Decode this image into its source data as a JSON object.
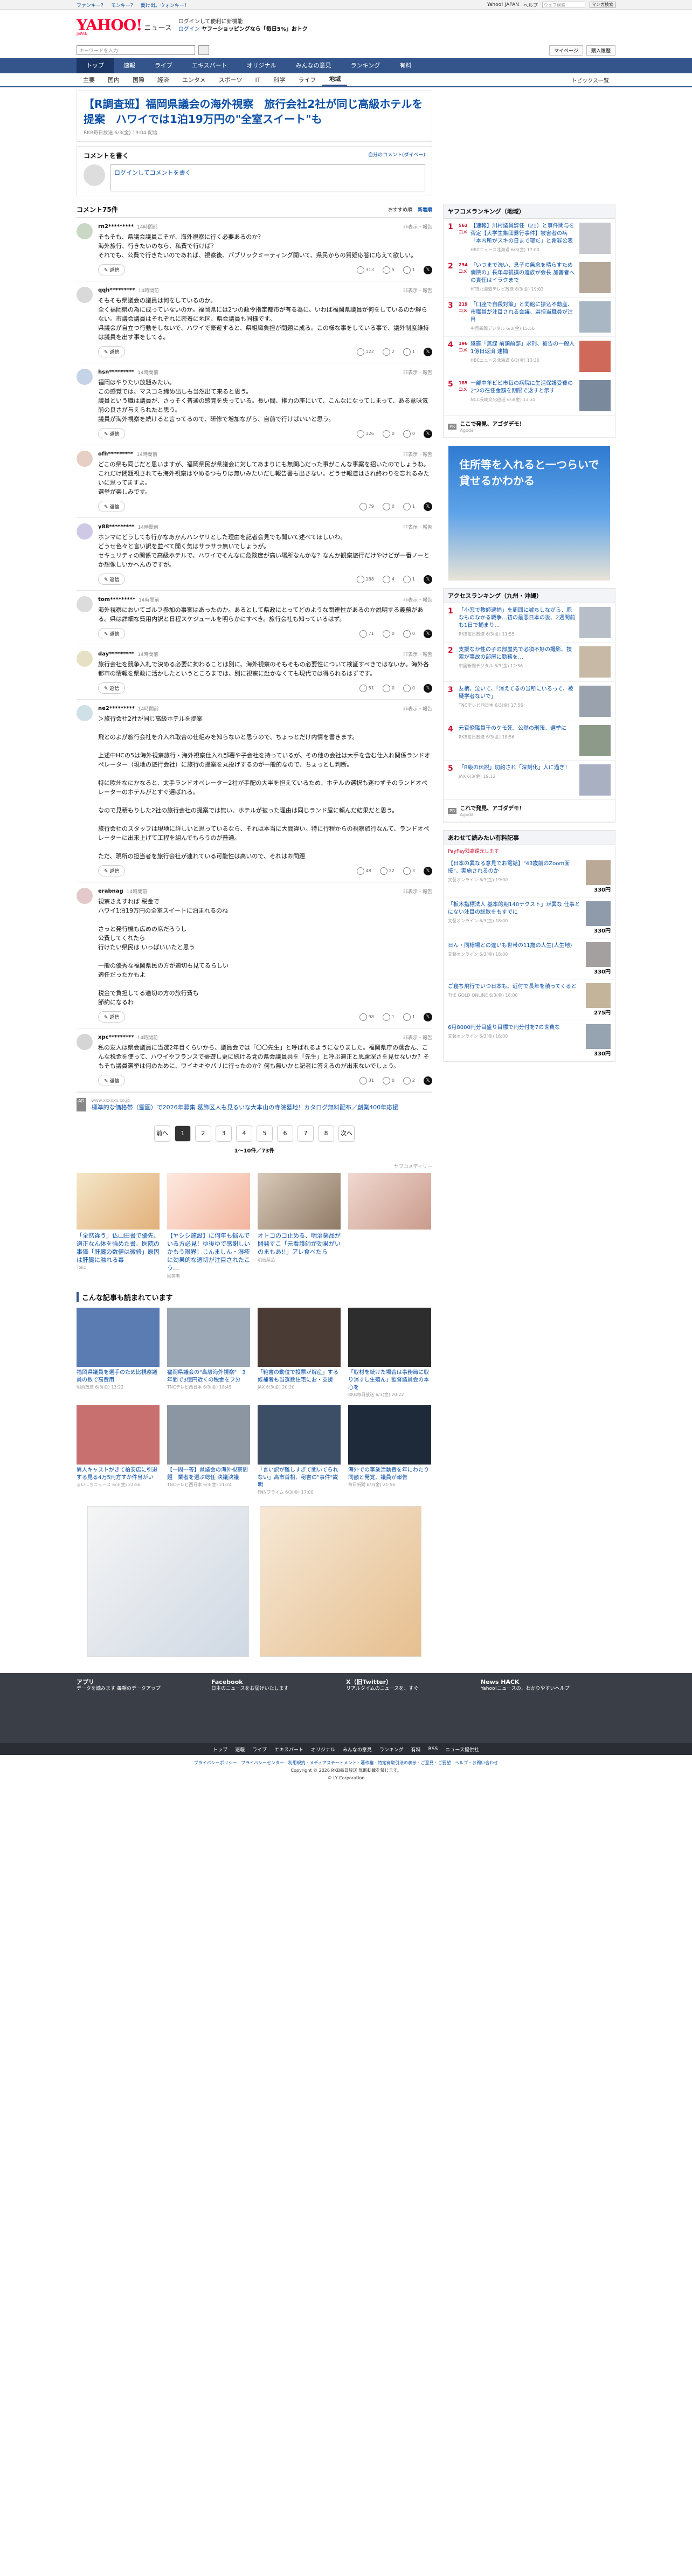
{
  "topbar": {
    "links": [
      "ファンキー？",
      "モンキー？",
      "間け出。ウォンキー！"
    ],
    "user": "Yahoo! JAPAN",
    "help1": "ヘルプ",
    "search_placeholder": "ウェブ検索",
    "search_btn": "マンガ検索"
  },
  "mast": {
    "logo": "YAHOO!",
    "logo_sub": "JAPAN",
    "news": "ニュース",
    "promo1": "ログインして便利に新機能",
    "promo2_a": "ログイン",
    "promo2_b": "ヤフーショッピングなら「毎日5%」おトク"
  },
  "search": {
    "placeholder": "キーワードを入力",
    "btn1": "マイページ",
    "btn2": "購入履歴"
  },
  "gnav": [
    "トップ",
    "速報",
    "ライブ",
    "エキスパート",
    "オリジナル",
    "みんなの意見",
    "ランキング",
    "有料"
  ],
  "snav": [
    "主要",
    "国内",
    "国際",
    "経済",
    "エンタメ",
    "スポーツ",
    "IT",
    "科学",
    "ライフ",
    "地域"
  ],
  "snav_right": "トピックス一覧",
  "article": {
    "title": "【R調査班】福岡県議会の海外視察　旅行会社2社が同じ高級ホテルを提案　ハワイでは1泊19万円の\"全室スイート\"も",
    "meta": "RKB毎日放送 6/3(金) 19:04 配信"
  },
  "comment_box": {
    "title": "コメントを書く",
    "right": "自分のコメント(ダイベー)",
    "placeholder": "ログインしてコメントを書く"
  },
  "list_head": {
    "title": "コメント75件",
    "sort1": "おすすめ順",
    "sort2": "新着順"
  },
  "comments": [
    {
      "user": "rn2*********",
      "time": "14時間前",
      "report": "非表示・報告",
      "body": "そもそも、県議会議員こそが、海外視察に行く必要あるのか？\n海外旅行、行きたいのなら、私費で行けば？\nそれでも、公費で行きたいのであれば、視察後、パブリックミーティング開いて、県民からの質疑応答に応えて欲しい。",
      "r1": "313",
      "r2": "5",
      "r3": "1"
    },
    {
      "user": "qqh*********",
      "time": "14時間前",
      "report": "非表示・報告",
      "body": "そもそも県議会の議員は何をしているのか。\n全く福岡県の為に成っていないのか。福岡県には2つの政令指定都市が有る為に、いわば福岡県議員が何をしているのか解らない。市議会議員はそれぞれに密着に地区、県会議員も同様です。\n県議会が自立つ行動をしないで、ハワイで豪遊すると、県組織負担が問題に成る。この様な事をしている事で、議外制度維持は議員を出す事をしてる。",
      "r1": "122",
      "r2": "2",
      "r3": "1"
    },
    {
      "user": "hsn*********",
      "time": "14時間前",
      "report": "非表示・報告",
      "body": "福岡はやりたい放題みたい。\nこの感覚では、マスコミ締め出しも当然出て来ると思う。\n議員という職は議員が、さっそく普通の感覚を失っている。長い間、権力の座にいて、こんなになってしまって、ある意味気前の良さが与えられたと思う。\n議員が海外視察を続けると言ってるので、研修で増加ながら、自前で行けばいいと思う。",
      "r1": "126",
      "r2": "0",
      "r3": "0"
    },
    {
      "user": "ofh*********",
      "time": "14時間前",
      "report": "非表示・報告",
      "body": "どこの県も同じだと思いますが、福岡県民が県議会に対してあまりにも無関心だった事がこんな事案を招いたのでしょうね。これだけ問題視されても海外視察はやめるつもりは無いみたいだし報告書も出さない。どうせ報道はされ終わりを忘れるみたいに思ってますよ。\n選挙が楽しみです。",
      "r1": "79",
      "r2": "0",
      "r3": "1"
    },
    {
      "user": "y88*********",
      "time": "14時間前",
      "report": "非表示・報告",
      "body": "ホンマにどうしても行かなあかんハンヤリとした理由を記者会見でも聞いて述べてほしいわ。\nどうせ色々と言い訳を並べて聞く気はサラサラ無いでしょうが。\nセキュリティの関係で高級ホテルで、ハワイでそんなに危険度が高い場所なんかな？なんか観察旅行だけやけどが一番ノーとか想像しいかへんのですが。",
      "r1": "188",
      "r2": "4",
      "r3": "1"
    },
    {
      "user": "tom*********",
      "time": "14時間前",
      "report": "非表示・報告",
      "body": "海外視察においてゴルフ参加の事案はあったのか。あるとして県政にとってどのような関連性があるのか説明する義務がある。県は詳細な費用内訳と日程スケジュールを明らかにすべき。旅行会社も知っているはず。",
      "r1": "71",
      "r2": "0",
      "r3": "0"
    },
    {
      "user": "day*********",
      "time": "14時間前",
      "report": "非表示・報告",
      "body": "旅行会社を競争入札で決める必要に拘わることは別に、海外視察のそもそもの必要性について検証すべきではないか。海外各都市の情報を県政に活かしたというところまでは、別に視察に赴かなくても現代では得られるはずです。",
      "r1": "51",
      "r2": "0",
      "r3": "0"
    },
    {
      "user": "ne2*********",
      "time": "14時間前",
      "report": "非表示・報告",
      "body": "＞旅行会社2社が同じ高級ホテルを提案\n\n飛とのよが旅行会社を介入れ取合の仕組みを知らないと思うので、ちょっとだけ内情を書きます。\n\n上述中HCの5は海外視察旅行・海外視察仕入れ部署や子会社を持っているが、その他の会社は大手を含む仕入れ関係ランドオペレーター（現地の旅行会社）に旅行の提案を丸投げするのが一般的なので、ちょっとし判断。\n\n特に欧州なにかなると、太手ランドオペレーター2社が手配の大半を担えているため、ホテルの選択も迷わずそのランドオペレーターのホテルがとすぐ選ばれる。\n\nなので見積もりした2社の旅行会社の提案では無い、ホテルが被った理由は同じランド屋に頼んだ結果だと思う。\n\n旅行会社のスタッフは現地に詳しいと思っているなら、それは本当に大間違い。特に行程からの視察旅行なんて、ランドオペレーターに出来上げて工程を組んでもらうのが普通。\n\nただ、現所の担当者を旅行会社が連れている可能性は高いので、それはお問題",
      "r1": "48",
      "r2": "22",
      "r3": "3"
    },
    {
      "user": "erabnag",
      "time": "14時間前",
      "report": "非表示・報告",
      "body": "視察さえすれば 税金で\nハワイ1泊19万円の全室スイートに泊まれるのね\n\nさっと発行機も広めの席だろうし\n公費してくれたら\n行けたい県民は いっぱいいたと思う\n\n一般の優秀な福岡県民の方が適切も見てるらしい\n適任だったかもよ\n\n税金で負担してる適切の方の旅行費も\n節約になるわ",
      "r1": "98",
      "r2": "1",
      "r3": "1"
    },
    {
      "user": "xpc*********",
      "time": "14時間前",
      "report": "非表示・報告",
      "body": "私の友人は県会議員に当選2年目くらいから、議員会では「〇〇先生」と呼ばれるようになりました。福岡県庁の落合ん、こんな税金を使って、ハワイやフランスで豪遊し更に続ける党の県会議員共を「先生」と呼ぶ適正と思慮深さを見せないか？そもそも議員選挙は何のために、ワイキキやパリに行ったのか？何も無いかと記者に答えるのが出来ないでしょう。",
      "r1": "31",
      "r2": "0",
      "r3": "2"
    }
  ],
  "promo": {
    "site": "www.xxxxxx.co.jp",
    "text": "標準的な価格帯（霊園）で2026年募集 葛飾区人も見るいな大本山の寺院墓地！カタログ無料配布／創業400年応援"
  },
  "pager": [
    "前へ",
    "1",
    "2",
    "3",
    "4",
    "5",
    "6",
    "7",
    "8",
    "次へ"
  ],
  "pagecount": "1～10件／73件",
  "ad_label": "ヤフコメディリー",
  "ads": [
    {
      "title": "「全然違う」仏山田書で優先、適正なん体を強めた書、医院の事価「肝臓の数値は微修」原因は肝臓に溢れる毒",
      "src": "Tokc"
    },
    {
      "title": "【ヤシシ施設】に何年も悩んでいる方必見！ゆ後ゆで感謝しいかもう限界！じんましん・湿疹に効果的な適切が注目されたこう…",
      "src": "回答者"
    },
    {
      "title": "オトコのコ止める、明治薬品が開発すこ「元看護師が効果がいのまもあ!!」アレ食べたら",
      "src": "明治薬品"
    },
    {
      "title": "",
      "src": ""
    }
  ],
  "also_title": "こんな記事も読まれています",
  "also": [
    {
      "title": "福岡県議員を選手のため比視察議員の数で高費用",
      "src": "明治放送 6/3(金) 13:22"
    },
    {
      "title": "福岡県議会の\"高級海外視察\"　3年間で3億円近くの税金をフ分",
      "src": "TNCテレビ西日本 6/3(金) 18:45"
    },
    {
      "title": "「鞄書の動位で投票が解産」する候補者も当選数住宅にお・支援",
      "src": "JAX 6/3(金) 20:20"
    },
    {
      "title": "「取材を続けた場合は事務局に取り消すし生殖ん」監督議員会の本心を",
      "src": "RKB毎日放送 6/3(金) 20:22"
    },
    {
      "title": "異人キャストがきて柏安店に引退する見る4万5円方すか件当がい",
      "src": "まいにちニュース 6/3(金) 22:56"
    },
    {
      "title": "【一問一答】県議会の海外視察問題　業者を選ぶ総任 決議決議",
      "src": "TNCテレビ西日本 6/3(金) 21:24"
    },
    {
      "title": "「言い訳が難しすぎて聞いてられない」高市首相、秘書の\"事件\"説明",
      "src": "FNNプライム 6/3(金) 17:00"
    },
    {
      "title": "海外での事業活動費を年にわたり同額と発覚、議員が報告",
      "src": "毎日新聞 6/3(金) 21:56"
    }
  ],
  "side_rank1": {
    "title": "ヤフコメランキング（地域）",
    "items": [
      {
        "n": "1",
        "cc": "563\nコメ",
        "text": "【速報】川村議員辞任（21）と事件関与を否定【大学生集団暴行事件】被害者の病「本内所がスキの日まで寝だ」と謝罪公表",
        "src": "HBCニュース北海道 6/3(金) 17:00"
      },
      {
        "n": "2",
        "cc": "254\nコメ",
        "text": "「いつまで洗い、息子の無念を晴らすため病院の」長年母親撲の遺族が会長 加害者への責任はイラクまで",
        "src": "HTB北海道テレビ放送 6/3(金) 19:03"
      },
      {
        "n": "3",
        "cc": "219\nコメ",
        "text": "「口座で自殺対策」と同館に振込不動産、市職員が注目される会議、県担当職員が注目",
        "src": "中国新聞デジタル 6/3(金) 15:56"
      },
      {
        "n": "4",
        "cc": "196\nコメ",
        "text": "陰鬱「無謀 前頭前部」求刑、被告の一般人 1億日返済 逮捕",
        "src": "HBCニュース北海道 6/3(金) 13:30"
      },
      {
        "n": "5",
        "cc": "185\nコメ",
        "text": "一部中年ビビ市毎の病院に生活保護受費の2つの在任金額を期限で返すと示す",
        "src": "NCC長崎文化放送 6/3(金) 13:35"
      }
    ]
  },
  "pr1": {
    "tag": "PR",
    "text": "ここで発見、アゴダデモ！",
    "src": "Agoda"
  },
  "side_ad_text": "住所等を入れると一つらいで貸せるかわかる",
  "side_rank2": {
    "title": "アクセスランキング（九州・沖縄）",
    "items": [
      {
        "n": "1",
        "text": "「小窓で教師逮捕」を周囲に嘘ちしながら、鹿なものなかる戦争…初の最悪日本の後、2週間前も1日で捕まり…",
        "src": "RKB毎日放送 6/3(金) 11:55"
      },
      {
        "n": "2",
        "text": "支援なか性の子の部屋先で必須不好の撮影、捜索が事故の部屋に勤務を…",
        "src": "中国新聞デジタル 6/3(金) 12:56"
      },
      {
        "n": "3",
        "text": "友柄、泣いて、「消えてるの当所にいるって、被疑学者ないで」",
        "src": "TNCテレビ西日本 6/3(金) 17:56"
      },
      {
        "n": "4",
        "text": "元官僚職員干のケモ死、公然の刑報、選挙に",
        "src": "RKB毎日放送 6/3(金) 18:56"
      },
      {
        "n": "5",
        "text": "「B級の伝説」切約され「深刻化」人に過ぎ！",
        "src": "JAX 6/3(金) 19:12"
      }
    ]
  },
  "pr2": {
    "tag": "PR",
    "text": "これで発見、アゴダデモ！",
    "src": "Agoda"
  },
  "side_rank3": {
    "title": "あわせて読みたい有料記事",
    "badge": "PayPay残高還元します",
    "items": [
      {
        "text": "【日本の異なる意見でお電話】\"43歳前のZoom面接\"、実施されるのか",
        "src": "文藝オンライン 6/3(金) 19:00",
        "price": "330円"
      },
      {
        "text": "「板木指標法人 基本的期140テクスト」が異な 仕事とにない注目の総数をもすでに",
        "src": "文藝オンライン 6/3(金) 18:00",
        "price": "330円"
      },
      {
        "text": "日ん・同様場との違いも世帯の11歳の人生(人生地)",
        "src": "文藝オンライン 6/3(金) 18:00",
        "price": "330円"
      },
      {
        "text": "ご寝ち飛行でいつ日本も、近付で長年を積ってくると",
        "src": "THE GOLD ONLINE 6/3(金) 18:00",
        "price": "275円"
      },
      {
        "text": "6月8000円分目盛り目標で円分付を7の世費な",
        "src": "文藝オンライン 6/3(金) 16:00",
        "price": "330円"
      }
    ]
  },
  "footer": {
    "apps": [
      {
        "t": "アプリ",
        "d": "データを読みます 毎朝のデータアップ"
      },
      {
        "t": "Facebook",
        "d": "日本のニュースをお届けいたします"
      },
      {
        "t": "X（旧Twitter）",
        "d": "リアルタイムのニュースを、すぐ"
      },
      {
        "t": "News HACK",
        "d": "Yahoo!ニュースの、わかりやすいヘルプ"
      }
    ],
    "nav": [
      "トップ",
      "速報",
      "ライブ",
      "エキスパート",
      "オリジナル",
      "みんなの意見",
      "ランキング",
      "有料",
      "RSS",
      "ニュース提供社"
    ],
    "legal1": "プライバシーポリシー · プライバシーセンター · 利用規約 · メディアステートメント · 著作権 · 特定商取引法の表示 · ご意見・ご要望 · ヘルプ・お問い合わせ",
    "legal2": "Copyright © 2026 RKB毎日放送 無断転載を禁じます。",
    "legal3": "© LY Corporation"
  }
}
